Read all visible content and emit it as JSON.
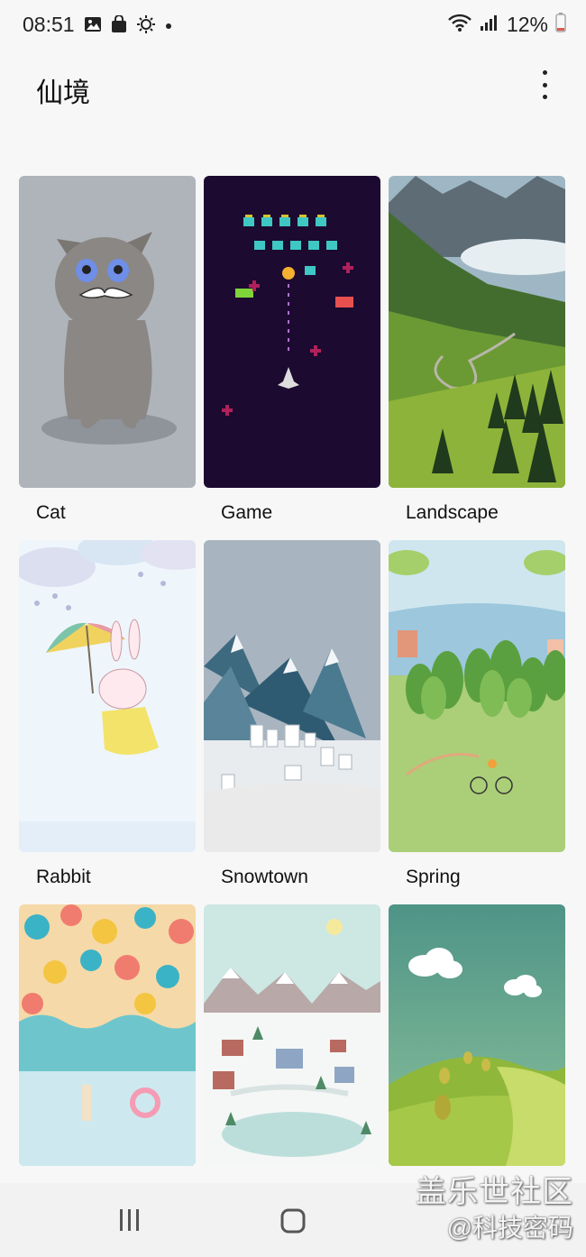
{
  "status": {
    "time": "08:51",
    "battery": "12%"
  },
  "app": {
    "title": "仙境"
  },
  "themes": [
    {
      "label": "Cat"
    },
    {
      "label": "Game"
    },
    {
      "label": "Landscape"
    },
    {
      "label": "Rabbit"
    },
    {
      "label": "Snowtown"
    },
    {
      "label": "Spring"
    },
    {
      "label": ""
    },
    {
      "label": ""
    },
    {
      "label": ""
    }
  ],
  "watermark": {
    "line1": "盖乐世社区",
    "line2": "@科技密码"
  }
}
